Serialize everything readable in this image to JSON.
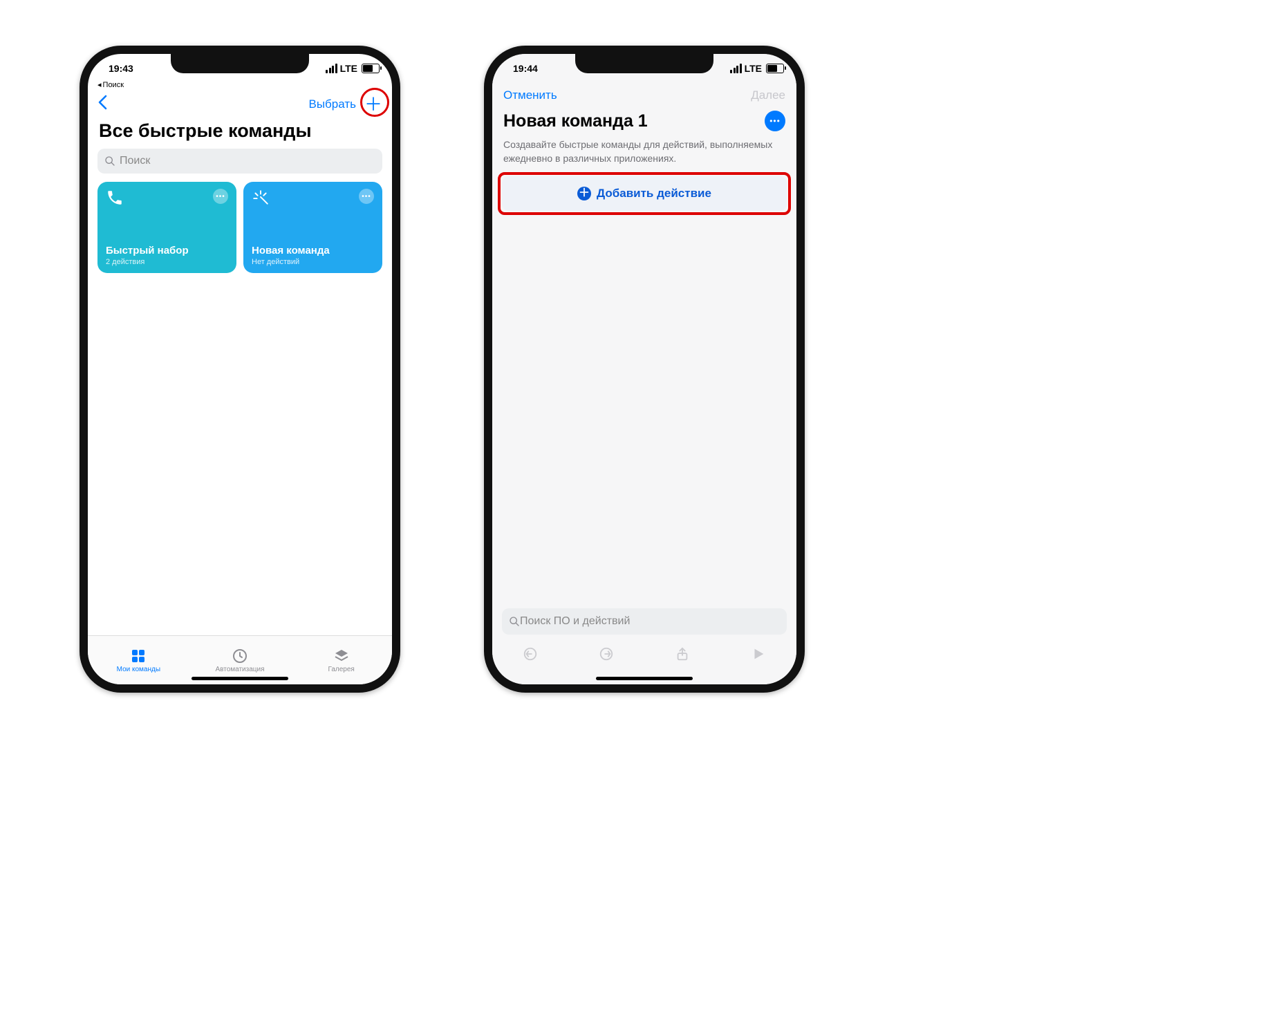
{
  "left": {
    "status": {
      "time": "19:43",
      "network": "LTE"
    },
    "back_search": "Поиск",
    "nav": {
      "select_label": "Выбрать"
    },
    "title": "Все быстрые команды",
    "search": {
      "placeholder": "Поиск"
    },
    "cards": [
      {
        "title": "Быстрый набор",
        "subtitle": "2 действия"
      },
      {
        "title": "Новая команда",
        "subtitle": "Нет действий"
      }
    ],
    "tabs": [
      {
        "label": "Мои команды"
      },
      {
        "label": "Автоматизация"
      },
      {
        "label": "Галерея"
      }
    ]
  },
  "right": {
    "status": {
      "time": "19:44",
      "network": "LTE"
    },
    "nav": {
      "cancel": "Отменить",
      "next": "Далее"
    },
    "title": "Новая команда 1",
    "description": "Создавайте быстрые команды для действий, выполняемых ежедневно в различных приложениях.",
    "add_action_label": "Добавить действие",
    "bottom_search": {
      "placeholder": "Поиск ПО и действий"
    }
  }
}
